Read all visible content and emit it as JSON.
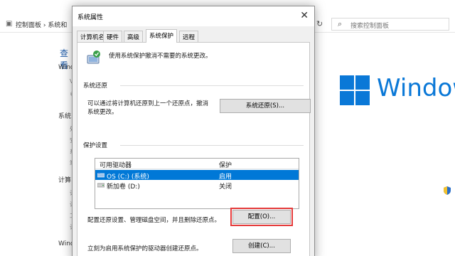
{
  "background": {
    "breadcrumb": "控制面板 › 系统和",
    "search_placeholder": "搜索控制面板",
    "left_heading": "查看",
    "left_items": [
      "Wind",
      "系统",
      "计算",
      "Wind"
    ],
    "windows_logo_text": "Window",
    "logo_color": "#0a78d7"
  },
  "dialog": {
    "title": "系统属性",
    "tabs": [
      "计算机名",
      "硬件",
      "高级",
      "系统保护",
      "远程"
    ],
    "active_tab": "系统保护",
    "intro_text": "使用系统保护撤消不需要的系统更改。",
    "restore_group": {
      "title": "系统还原",
      "description_line1": "可以通过将计算机还原到上一个还原点，撤消",
      "description_line2": "系统更改。",
      "button": "系统还原(S)..."
    },
    "protection_group": {
      "title": "保护设置",
      "columns": [
        "可用驱动器",
        "保护"
      ],
      "drives": [
        {
          "name": "OS (C:) (系统)",
          "status": "启用",
          "selected": true
        },
        {
          "name": "新加卷 (D:)",
          "status": "关闭",
          "selected": false
        }
      ],
      "configure_text": "配置还原设置、管理磁盘空间，并且删除还原点。",
      "configure_button": "配置(O)...",
      "create_text": "立刻为启用系统保护的驱动器创建还原点。",
      "create_button": "创建(C)..."
    },
    "selection_color": "#0078d7",
    "highlight_color": "#e53a3a"
  }
}
